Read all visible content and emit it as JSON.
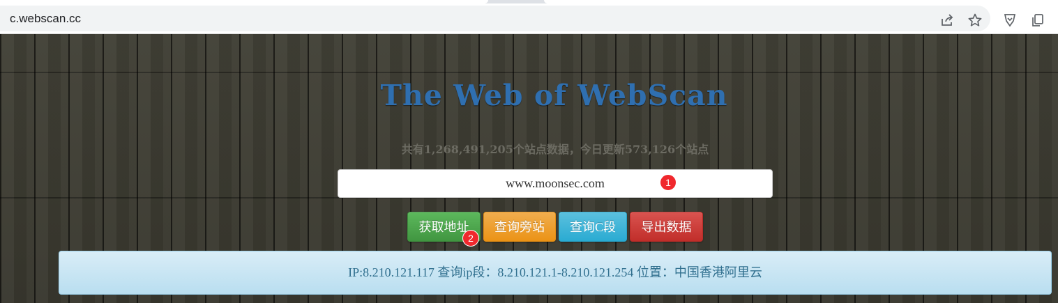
{
  "browser": {
    "url": "c.webscan.cc",
    "icons": [
      "share-icon",
      "star-icon",
      "extension-icon",
      "copy-icon"
    ]
  },
  "page": {
    "title": "The Web of WebScan",
    "stats": "共有1,268,491,205个站点数据，今日更新573,126个站点",
    "search_value": "www.moonsec.com",
    "badges": {
      "first": "1",
      "second": "2"
    },
    "buttons": {
      "get_address": "获取地址",
      "query_side": "查询旁站",
      "query_c": "查询C段",
      "export": "导出数据"
    },
    "result": "IP:8.210.121.117 查询ip段：8.210.121.1-8.210.121.254 位置：中国香港阿里云"
  },
  "colors": {
    "title": "#2f6fb0",
    "green": "#5cb85c",
    "orange": "#f0ad4e",
    "blue": "#5bc0de",
    "red": "#d9534f",
    "badge": "#f0282d",
    "alert_bg": "#d9edf7",
    "alert_text": "#31708f"
  }
}
